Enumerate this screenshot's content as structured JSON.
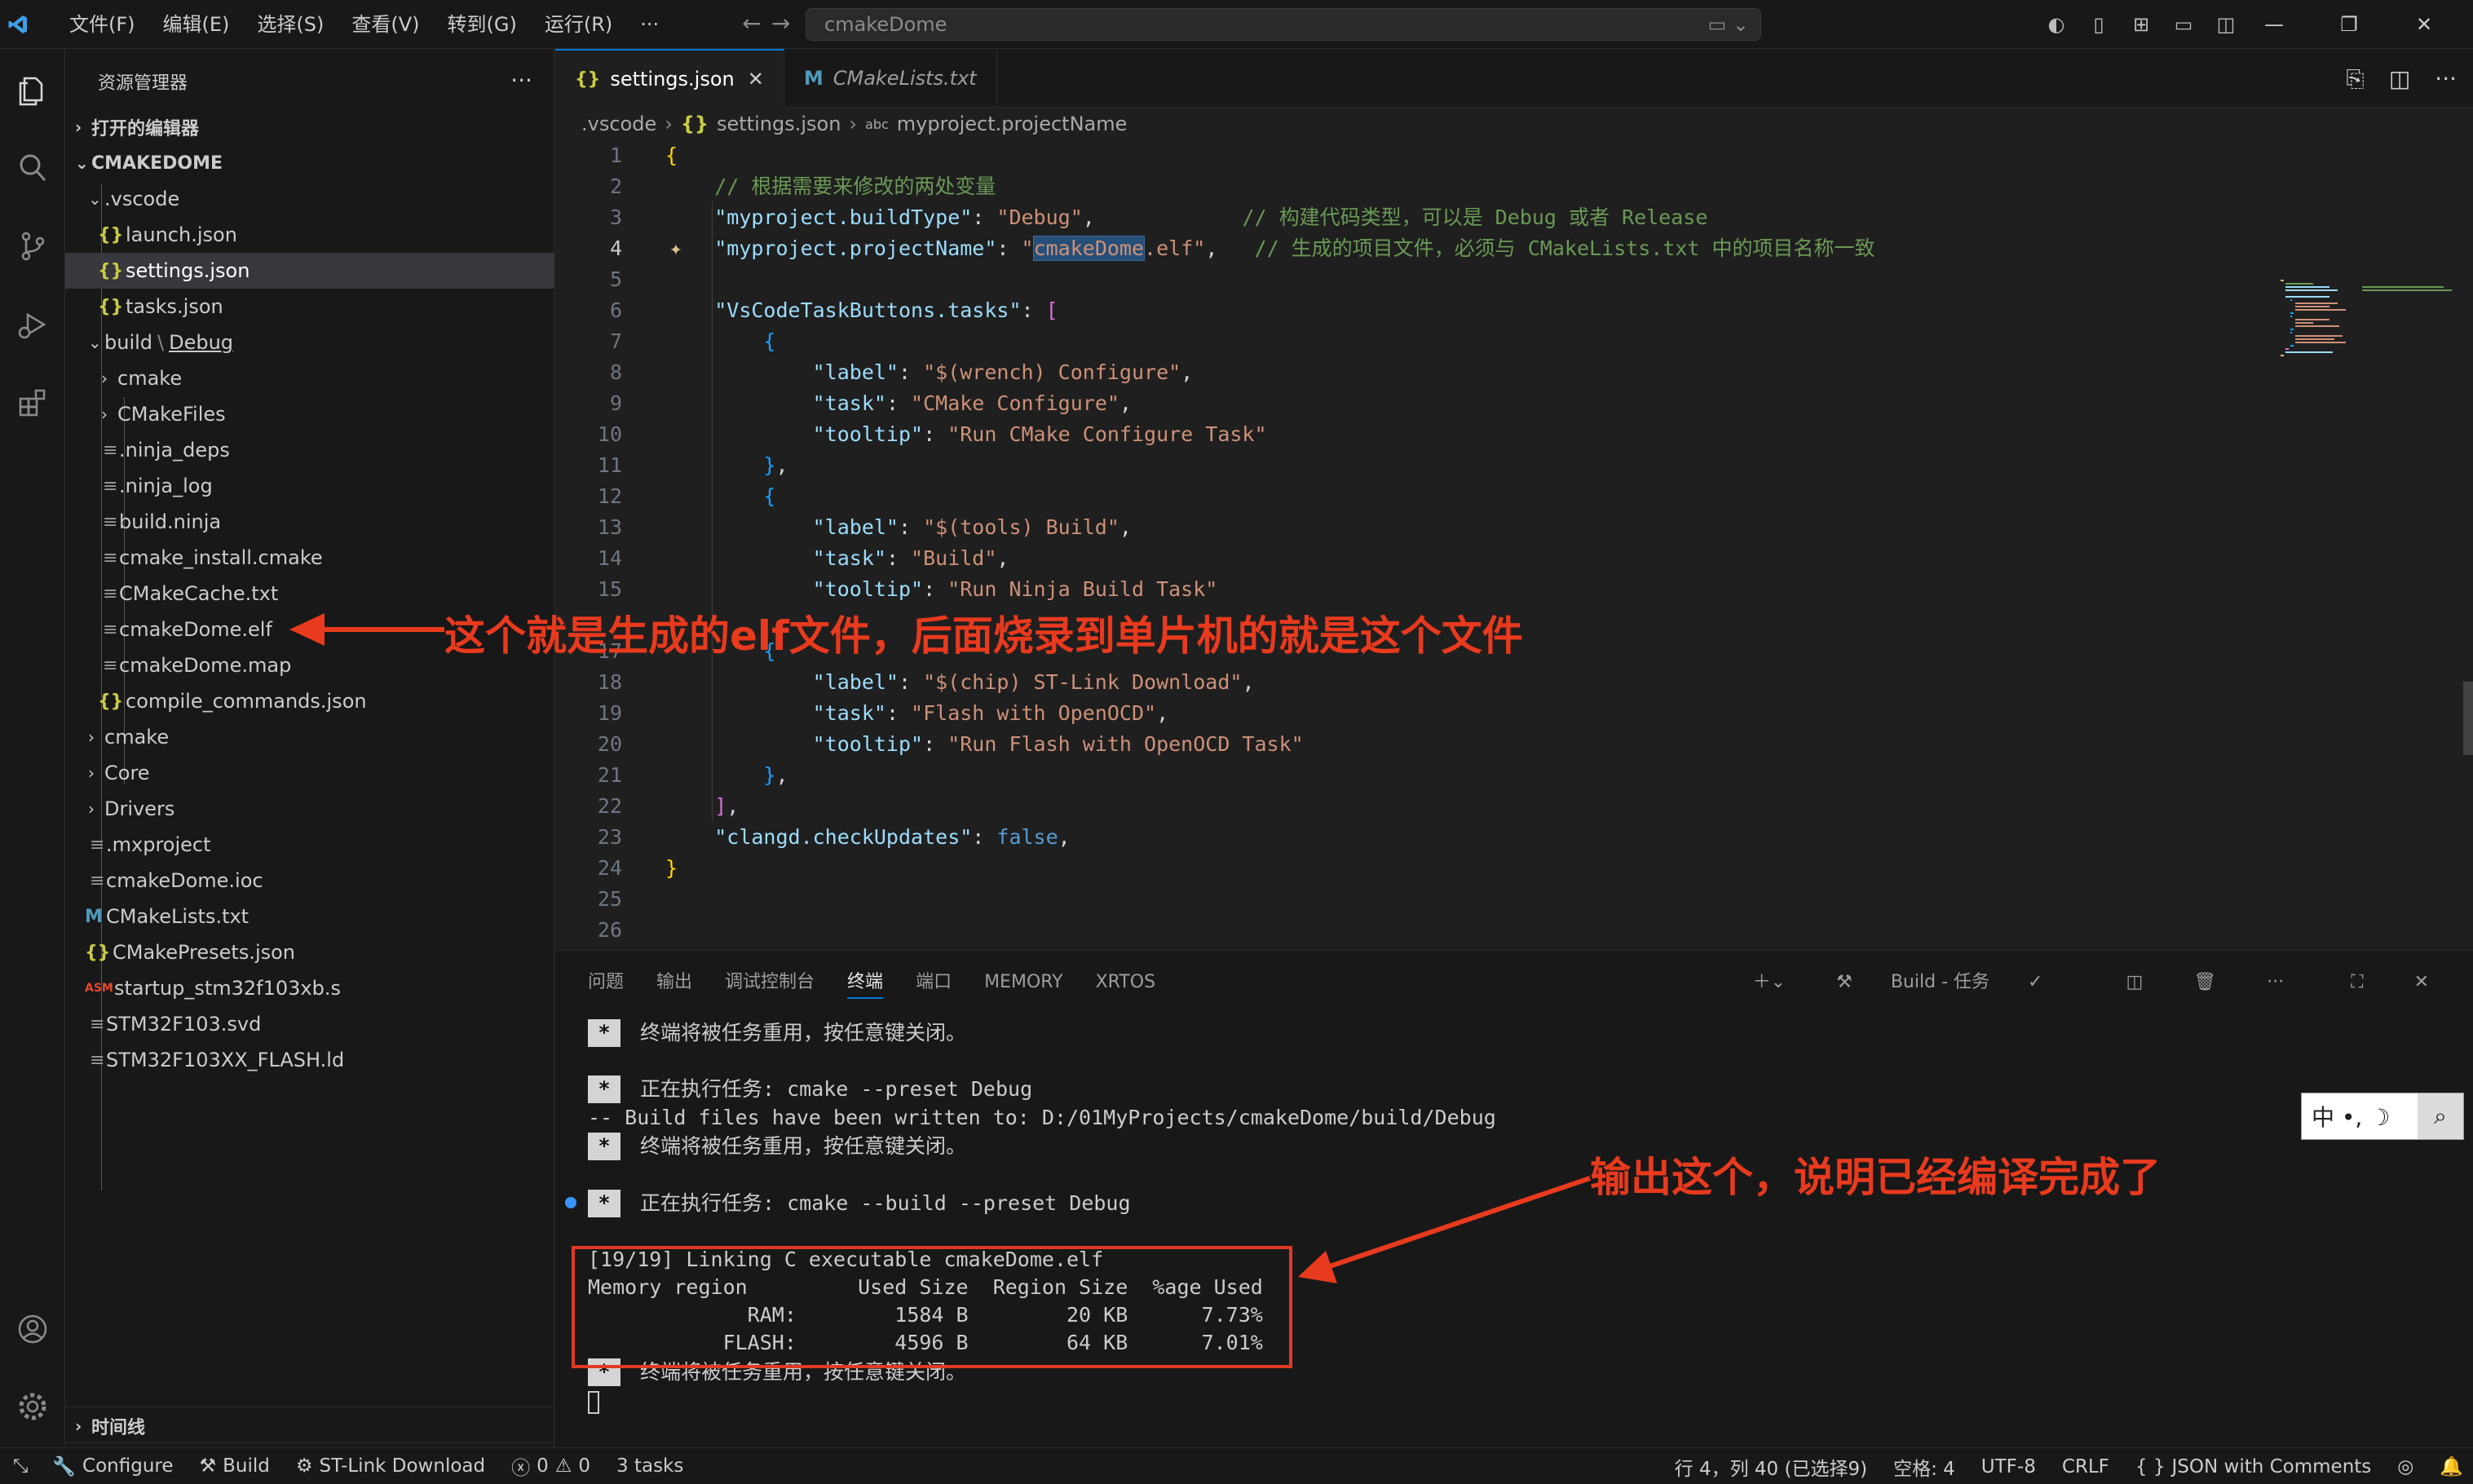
{
  "titlebar": {
    "menus": [
      "文件(F)",
      "编辑(E)",
      "选择(S)",
      "查看(V)",
      "转到(G)",
      "运行(R)",
      "···"
    ],
    "search": "cmakeDome"
  },
  "sidebar": {
    "title": "资源管理器",
    "open_editors": "打开的编辑器",
    "project": "CMAKEDOME",
    "items": [
      {
        "label": ".vscode",
        "type": "folder"
      },
      {
        "label": "launch.json",
        "type": "json"
      },
      {
        "label": "settings.json",
        "type": "json"
      },
      {
        "label": "tasks.json",
        "type": "json"
      },
      {
        "label": "build",
        "sub": "Debug",
        "type": "folder"
      },
      {
        "label": "cmake",
        "type": "folder"
      },
      {
        "label": "CMakeFiles",
        "type": "folder"
      },
      {
        "label": ".ninja_deps",
        "type": "file"
      },
      {
        "label": ".ninja_log",
        "type": "file"
      },
      {
        "label": "build.ninja",
        "type": "file"
      },
      {
        "label": "cmake_install.cmake",
        "type": "file"
      },
      {
        "label": "CMakeCache.txt",
        "type": "file"
      },
      {
        "label": "cmakeDome.elf",
        "type": "file"
      },
      {
        "label": "cmakeDome.map",
        "type": "file"
      },
      {
        "label": "compile_commands.json",
        "type": "json"
      },
      {
        "label": "cmake",
        "type": "folder"
      },
      {
        "label": "Core",
        "type": "folder"
      },
      {
        "label": "Drivers",
        "type": "folder"
      },
      {
        "label": ".mxproject",
        "type": "file"
      },
      {
        "label": "cmakeDome.ioc",
        "type": "file"
      },
      {
        "label": "CMakeLists.txt",
        "type": "cmake"
      },
      {
        "label": "CMakePresets.json",
        "type": "json"
      },
      {
        "label": "startup_stm32f103xb.s",
        "type": "asm"
      },
      {
        "label": "STM32F103.svd",
        "type": "file"
      },
      {
        "label": "STM32F103XX_FLASH.ld",
        "type": "file"
      }
    ],
    "timeline": "时间线",
    "outline": "大纲"
  },
  "editor": {
    "tabs": [
      {
        "label": "settings.json",
        "active": true
      },
      {
        "label": "CMakeLists.txt",
        "active": false
      }
    ],
    "breadcrumb": [
      ".vscode",
      "settings.json",
      "myproject.projectName"
    ],
    "line_numbers": [
      "1",
      "2",
      "3",
      "4",
      "5",
      "6",
      "7",
      "8",
      "9",
      "10",
      "11",
      "12",
      "13",
      "14",
      "15",
      "",
      "17",
      "18",
      "19",
      "20",
      "21",
      "22",
      "23",
      "24",
      "25",
      "26"
    ]
  },
  "panel": {
    "tabs": [
      "问题",
      "输出",
      "调试控制台",
      "终端",
      "端口",
      "MEMORY",
      "XRTOS"
    ],
    "active_tab": "终端",
    "task_label": "Build - 任务",
    "lines": {
      "reuse1": "终端将被任务重用，按任意键关闭。",
      "exec1": "正在执行任务: cmake --preset Debug",
      "written": "-- Build files have been written to: D:/01MyProjects/cmakeDome/build/Debug",
      "reuse2": "终端将被任务重用，按任意键关闭。",
      "exec2": "正在执行任务: cmake --build --preset Debug",
      "link": "[19/19] Linking C executable cmakeDome.elf",
      "mem_header": "Memory region         Used Size  Region Size  %age Used",
      "ram": "             RAM:        1584 B        20 KB      7.73%",
      "flash": "           FLASH:        4596 B        64 KB      7.01%",
      "reuse3": "终端将被任务重用，按任意键关闭。"
    },
    "ime": "中 •, ☽"
  },
  "statusbar": {
    "configure": "Configure",
    "build": "Build",
    "stlink": "ST-Link Download",
    "errors": "0",
    "warnings": "0",
    "tasks": "3 tasks",
    "position": "行 4，列 40 (已选择9)",
    "spaces": "空格: 4",
    "encoding": "UTF-8",
    "eol": "CRLF",
    "language": "JSON with Comments"
  },
  "annotations": {
    "elf": "这个就是生成的elf文件，后面烧录到单片机的就是这个文件",
    "output": "输出这个，说明已经编译完成了"
  },
  "colors": {
    "accent": "#0078d4",
    "annotation": "#e83a1e"
  }
}
